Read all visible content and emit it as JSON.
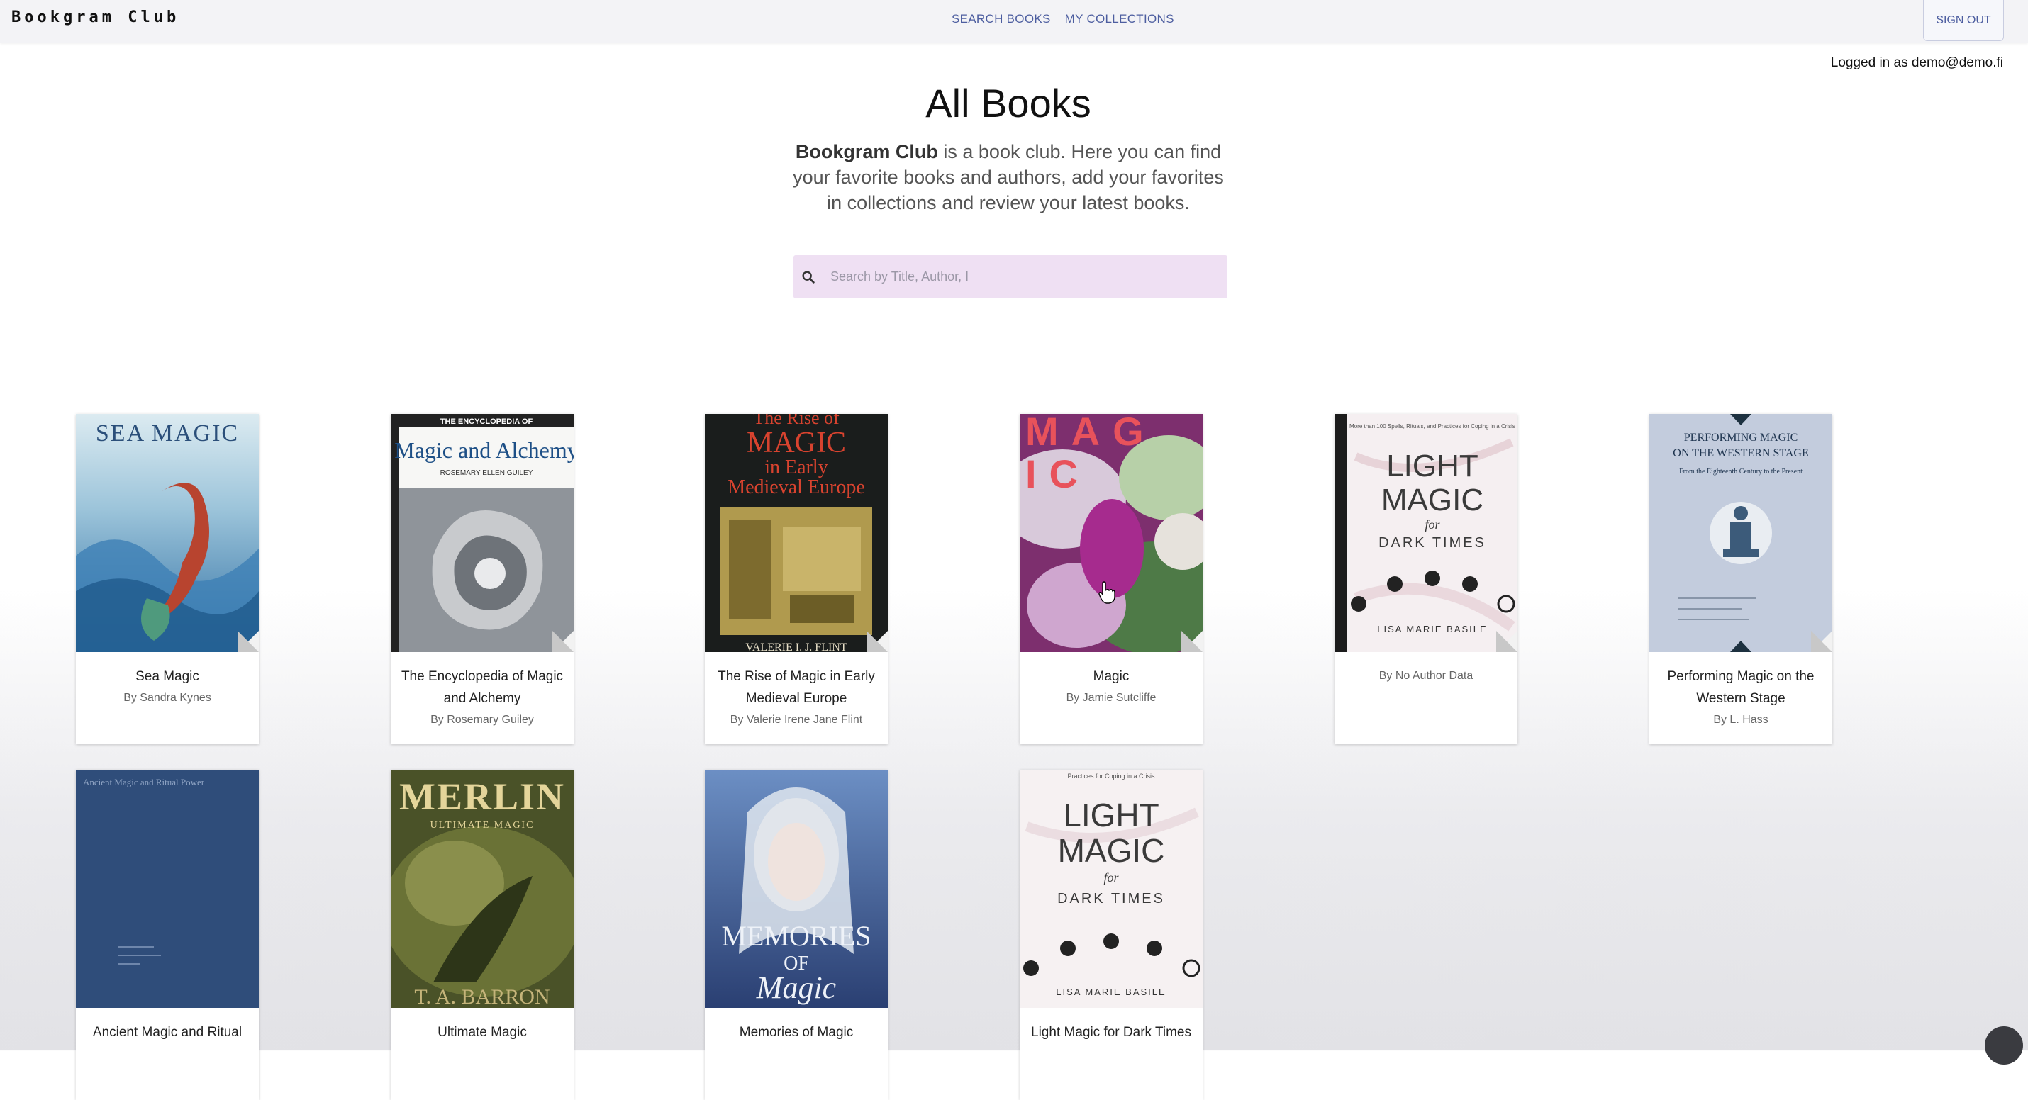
{
  "app": {
    "brand": "Bookgram Club"
  },
  "nav": {
    "links": [
      "SEARCH BOOKS",
      "MY COLLECTIONS"
    ],
    "sign_out": "SIGN OUT"
  },
  "user": {
    "logged_in": "Logged in as demo@demo.fi"
  },
  "hero": {
    "title": "All Books",
    "intro_bold": "Bookgram Club",
    "intro_rest": " is a book club. Here you can find your favorite books and authors, add your favorites in collections and review your latest books."
  },
  "search": {
    "placeholder": "Search by Title, Author, I"
  },
  "books": [
    {
      "title": "Sea Magic",
      "author": "By Sandra Kynes"
    },
    {
      "title": "The Encyclopedia of Magic and Alchemy",
      "author": "By Rosemary Guiley"
    },
    {
      "title": "The Rise of Magic in Early Medieval Europe",
      "author": "By Valerie Irene Jane Flint"
    },
    {
      "title": "Magic",
      "author": "By Jamie Sutcliffe"
    },
    {
      "title": "",
      "author": "By No Author Data"
    },
    {
      "title": "Performing Magic on the Western Stage",
      "author": "By L. Hass"
    },
    {
      "title": "Ancient Magic and Ritual",
      "author": ""
    },
    {
      "title": "Ultimate Magic",
      "author": ""
    },
    {
      "title": "Memories of Magic",
      "author": ""
    },
    {
      "title": "Light Magic for Dark Times",
      "author": ""
    }
  ],
  "cover_text": {
    "sea_magic": "SEA MAGIC",
    "enc_top": "THE ENCYCLOPEDIA OF",
    "enc_main": "Magic and Alchemy",
    "enc_author": "ROSEMARY ELLEN GUILEY",
    "rise_1": "The Rise of",
    "rise_2": "MAGIC",
    "rise_3": "in Early",
    "rise_4": "Medieval Europe",
    "rise_author": "VALERIE I. J. FLINT",
    "magic_1": "MAG",
    "magic_2": "IC",
    "light_top": "More than 100 Spells, Rituals, and Practices for Coping in a Crisis",
    "light_1": "LIGHT",
    "light_2": "MAGIC",
    "light_3": "for",
    "light_4": "DARK TIMES",
    "light_author": "LISA MARIE BASILE",
    "perf_1": "PERFORMING MAGIC",
    "perf_2": "ON THE WESTERN STAGE",
    "perf_sub": "From the Eighteenth Century to the Present",
    "anc": "Ancient Magic and Ritual Power",
    "merlin": "MERLIN",
    "merlin_sub": "ULTIMATE MAGIC",
    "merlin_author": "T. A. BARRON",
    "mem_1": "MEMORIES",
    "mem_2": "OF",
    "mem_3": "Magic",
    "light2_top": "Practices for Coping in a Crisis"
  },
  "colors": {
    "search_bg": "#efe0f3",
    "nav_link": "#4d5ea0",
    "topbar": "#f3f3f6"
  },
  "icons": {
    "search": "search-icon",
    "cursor": "hand-cursor-icon"
  }
}
